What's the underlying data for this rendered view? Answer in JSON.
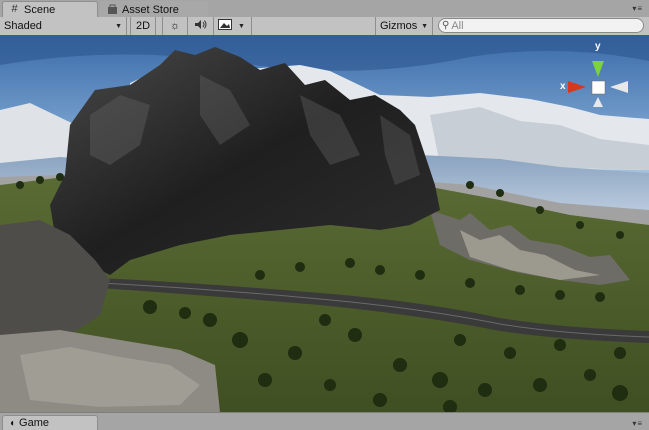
{
  "tabs": [
    {
      "label": "Scene",
      "icon": "grid-icon",
      "active": true
    },
    {
      "label": "Asset Store",
      "icon": "shop-icon",
      "active": false
    }
  ],
  "toolbar": {
    "shading_mode": "Shaded",
    "mode_2d": "2D",
    "lighting_icon": "sun-icon",
    "audio_icon": "speaker-icon",
    "effects_icon": "image-icon",
    "gizmos_label": "Gizmos",
    "search_placeholder": "All"
  },
  "gizmo": {
    "y_label": "y",
    "x_label": "x",
    "y_color": "#7cd33b",
    "x_color": "#d8371f"
  },
  "bottom_tabs": [
    {
      "label": "Game",
      "icon": "pacman-icon"
    }
  ]
}
